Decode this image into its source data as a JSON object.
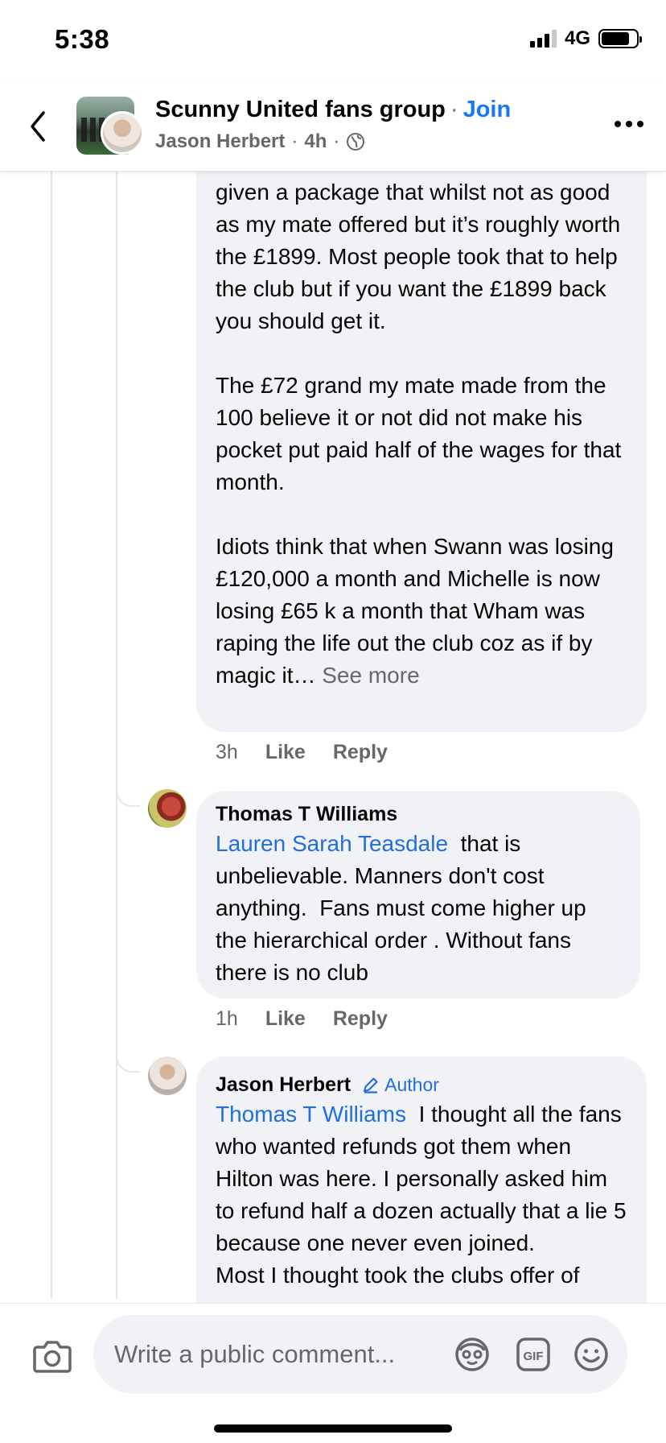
{
  "status_bar": {
    "time": "5:38",
    "network": "4G"
  },
  "header": {
    "group_name": "Scunny United fans group",
    "separator": "·",
    "join_label": "Join",
    "poster": "Jason Herbert",
    "time_ago": "4h",
    "privacy_icon": "globe-icon"
  },
  "comments": [
    {
      "paragraphs": [
        "given a package that whilst not as good as my mate offered but it’s roughly worth the £1899. Most people took that to help the club but if you want the £1899 back you should get it.",
        "The £72 grand my mate made from the 100 believe it or not did not make his pocket put paid half of the wages for that month.",
        "Idiots think that when Swann was losing £120,000 a month and Michelle is now losing £65 k a month that Wham was raping the life out the club coz as if by magic it…"
      ],
      "see_more": "See more",
      "time": "3h",
      "like_label": "Like",
      "reply_label": "Reply"
    },
    {
      "author": "Thomas T Williams",
      "mention": "Lauren Sarah Teasdale",
      "text": "  that is unbelievable. Manners don't cost anything.  Fans must come higher up the hierarchical order . Without fans there is no club",
      "time": "1h",
      "like_label": "Like",
      "reply_label": "Reply"
    },
    {
      "author": "Jason Herbert",
      "badge": "Author",
      "mention": "Thomas T Williams",
      "text": "  I thought all the fans who wanted refunds got them when Hilton was here. I personally asked him to refund half a dozen actually that a lie 5 because one never even joined.",
      "cut_text": "Most I thought took the clubs offer of"
    }
  ],
  "composer": {
    "placeholder": "Write a public comment...",
    "icons": [
      "camera-icon",
      "avatar-sticker-icon",
      "gif-icon",
      "emoji-icon"
    ]
  },
  "colors": {
    "link": "#216fdb",
    "join": "#1877f2",
    "bubble": "#f0f2f5",
    "muted": "#65676b"
  }
}
